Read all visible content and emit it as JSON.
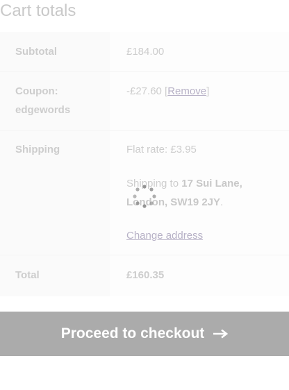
{
  "title": "Cart totals",
  "subtotal": {
    "label": "Subtotal",
    "value": "£184.00"
  },
  "coupon": {
    "label_line1": "Coupon:",
    "label_line2": "edgewords",
    "amount": "-£27.60",
    "remove_label": "Remove"
  },
  "shipping": {
    "label": "Shipping",
    "method": "Flat rate: £3.95",
    "prefix": "Shipping to ",
    "address_line1": "17 Sui Lane,",
    "address_line2_pre": "London, SW19 2JY",
    "change_address_label": "Change address"
  },
  "total": {
    "label": "Total",
    "value": "£160.35"
  },
  "checkout": {
    "label": "Proceed to checkout",
    "icon": "arrow-right-icon"
  },
  "colors": {
    "button_bg": "#ababab",
    "link": "#b7b1c6"
  }
}
